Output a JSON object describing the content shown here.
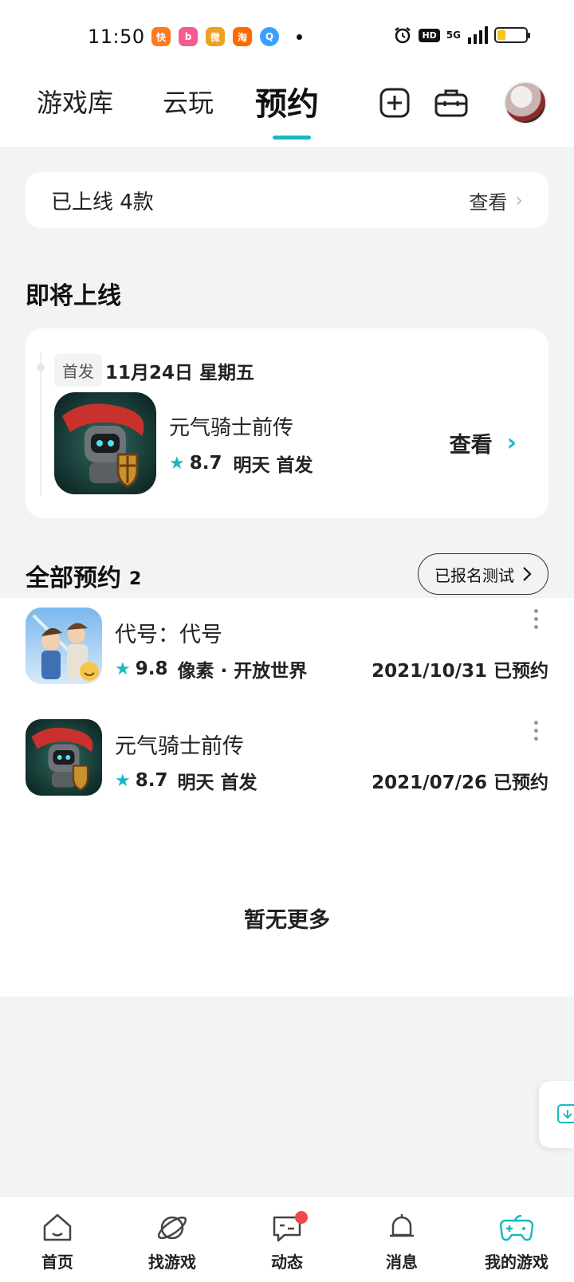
{
  "status_bar": {
    "time": "11:50",
    "apps": [
      {
        "icon": "kuaishou-icon",
        "glyph": "快",
        "color": "#ff7a1a"
      },
      {
        "icon": "bilibili-icon",
        "glyph": "b",
        "color": "#f25d8e"
      },
      {
        "icon": "weibo-icon",
        "glyph": "微",
        "color": "#f0a020"
      },
      {
        "icon": "taobao-icon",
        "glyph": "淘",
        "color": "#ff6a00"
      },
      {
        "icon": "qq-browser-icon",
        "glyph": "Q",
        "color": "#3aa0ff"
      }
    ],
    "hd": "HD",
    "network": "5G",
    "battery_level": 0.3
  },
  "top_nav": {
    "tabs": [
      {
        "label": "游戏库",
        "active": false
      },
      {
        "label": "云玩",
        "active": false
      },
      {
        "label": "预约",
        "active": true
      }
    ]
  },
  "online": {
    "text": "已上线 4款",
    "link": "查看"
  },
  "upcoming": {
    "title": "即将上线",
    "badge": "首发",
    "date": "11月24日 星期五",
    "game_name": "元气骑士前传",
    "rating": "8.7",
    "status": "明天 首发",
    "action": "查看"
  },
  "reservations": {
    "title": "全部预约",
    "count": "2",
    "test_button": "已报名测试",
    "items": [
      {
        "name": "代号：代号",
        "rating": "9.8",
        "tags": "像素 · 开放世界",
        "date": "2021/10/31 已预约"
      },
      {
        "name": "元气骑士前传",
        "rating": "8.7",
        "tags": "明天 首发",
        "date": "2021/07/26 已预约"
      }
    ]
  },
  "no_more": "暂无更多",
  "bottom_nav": [
    {
      "label": "首页",
      "icon": "home-icon",
      "active": false
    },
    {
      "label": "找游戏",
      "icon": "planet-icon",
      "active": false
    },
    {
      "label": "动态",
      "icon": "chat-icon",
      "active": false,
      "badge": true
    },
    {
      "label": "消息",
      "icon": "bell-icon",
      "active": false
    },
    {
      "label": "我的游戏",
      "icon": "gamepad-icon",
      "active": true
    }
  ],
  "colors": {
    "accent": "#1ab8c4",
    "badge_red": "#f04848"
  }
}
